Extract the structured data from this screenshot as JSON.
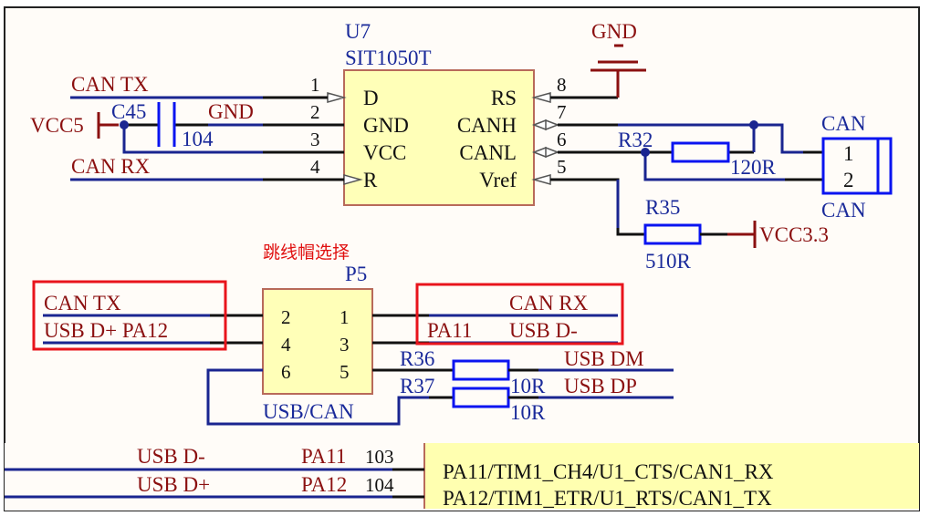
{
  "colors": {
    "net_label": "#8b1010",
    "designator": "#1a2a9a",
    "wire": "#1a2590",
    "component": "#0a14f0",
    "chip_fill": "#ffffb8",
    "highlight": "#e8141c",
    "annotation": "#e01010"
  },
  "u7": {
    "designator": "U7",
    "part": "SIT1050T",
    "left_pins": [
      {
        "num": "1",
        "name": "D"
      },
      {
        "num": "2",
        "name": "GND"
      },
      {
        "num": "3",
        "name": "VCC"
      },
      {
        "num": "4",
        "name": "R"
      }
    ],
    "right_pins": [
      {
        "num": "8",
        "name": "RS"
      },
      {
        "num": "7",
        "name": "CANH"
      },
      {
        "num": "6",
        "name": "CANL"
      },
      {
        "num": "5",
        "name": "Vref"
      }
    ]
  },
  "nets": {
    "can_tx": "CAN TX",
    "can_rx": "CAN RX",
    "vcc5": "VCC5",
    "gnd": "GND",
    "gnd_top": "GND",
    "vcc33": "VCC3.3"
  },
  "c45": {
    "designator": "C45",
    "value": "104"
  },
  "r32": {
    "designator": "R32",
    "value": "120R"
  },
  "r35": {
    "designator": "R35",
    "value": "510R"
  },
  "can_connector": {
    "designator": "CAN",
    "comment": "CAN",
    "pins": [
      "1",
      "2"
    ]
  },
  "jumper_note": "跳线帽选择",
  "p5": {
    "designator": "P5",
    "comment": "USB/CAN",
    "pins": [
      "2",
      "1",
      "4",
      "3",
      "6",
      "5"
    ],
    "left_labels": [
      "CAN TX",
      "USB D+ PA12"
    ],
    "right_labels": [
      "CAN RX",
      "PA11",
      "USB D-"
    ]
  },
  "r36": {
    "designator": "R36",
    "value": "10R",
    "net": "USB DM"
  },
  "r37": {
    "designator": "R37",
    "value": "10R",
    "net": "USB DP"
  },
  "mcu": {
    "rows": [
      {
        "net": "USB D-",
        "pin_name": "PA11",
        "pin_num": "103",
        "function": "PA11/TIM1_CH4/U1_CTS/CAN1_RX"
      },
      {
        "net": "USB D+",
        "pin_name": "PA12",
        "pin_num": "104",
        "function": "PA12/TIM1_ETR/U1_RTS/CAN1_TX"
      }
    ]
  }
}
